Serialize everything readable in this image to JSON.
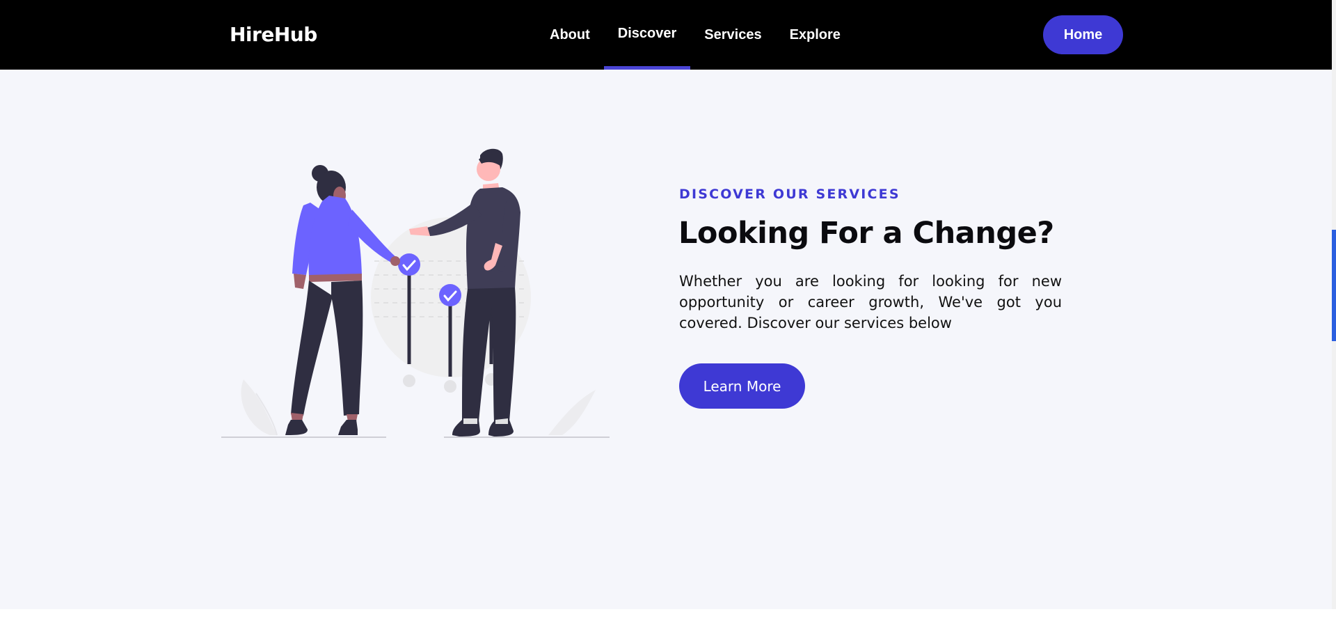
{
  "brand": {
    "name": "HireHub"
  },
  "nav": {
    "items": [
      {
        "label": "About"
      },
      {
        "label": "Discover"
      },
      {
        "label": "Services"
      },
      {
        "label": "Explore"
      }
    ],
    "active": "Discover",
    "home_label": "Home"
  },
  "hero": {
    "eyebrow": "DISCOVER OUR SERVICES",
    "title": "Looking For a Change?",
    "description": "Whether you are looking for looking for new opportunity or career growth, We've got you covered. Discover our services below",
    "cta_label": "Learn More"
  },
  "colors": {
    "accent": "#3e39d4",
    "illustration_purple": "#6c63ff",
    "dark_figure": "#2f2e41",
    "page_background": "#f5f6fb",
    "navbar_background": "#000000"
  }
}
